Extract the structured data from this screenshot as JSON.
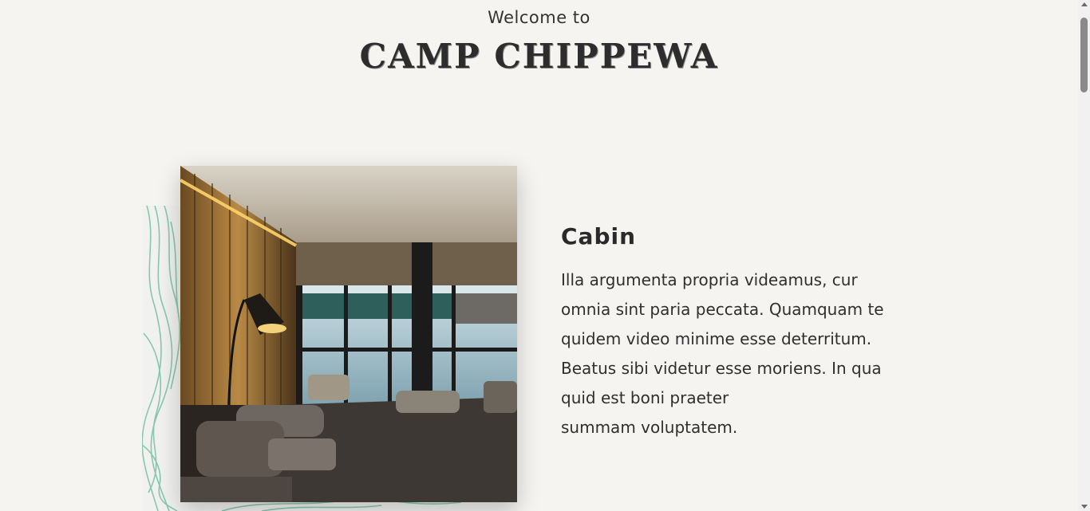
{
  "header": {
    "welcome": "Welcome to",
    "title": "CAMP CHIPPEWA"
  },
  "feature": {
    "image_alt": "Cabin living room with lake view",
    "title": "Cabin",
    "lines": [
      "Illa argumenta propria videamus, cur",
      "omnia sint paria peccata. Quamquam te",
      "quidem video minime esse deterritum.",
      "Beatus sibi videtur esse moriens. In qua",
      "quid est boni praeter",
      "summam voluptatem."
    ]
  },
  "colors": {
    "background": "#f5f4f1",
    "topo_line": "#7cc3a8",
    "text": "#2b2b2b"
  }
}
